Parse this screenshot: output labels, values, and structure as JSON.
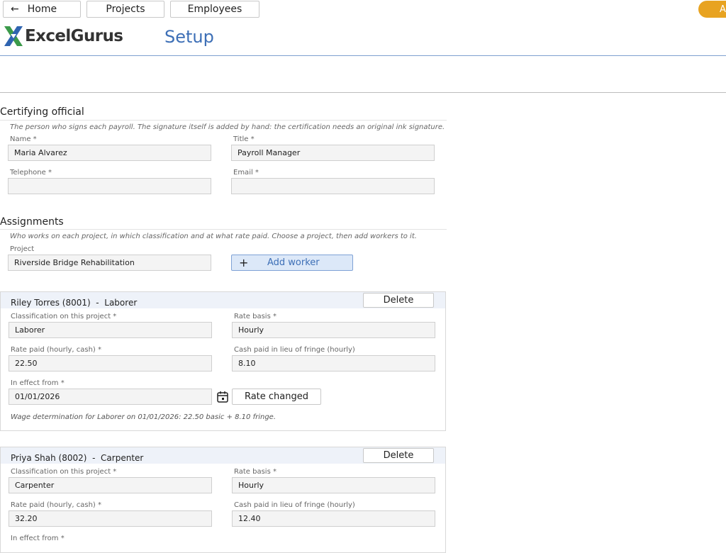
{
  "nav": {
    "home_label": "Home",
    "projects_label": "Projects",
    "employees_label": "Employees",
    "account_initial": "A"
  },
  "brand": {
    "name": "ExcelGurus"
  },
  "page": {
    "title": "Setup"
  },
  "certifying": {
    "title": "Certifying official",
    "hint": "The person who signs each payroll. The signature itself is added by hand: the certification needs an original ink signature.",
    "name_label": "Name *",
    "name_value": "Maria Alvarez",
    "title_label": "Title *",
    "title_value": "Payroll Manager",
    "phone_label": "Telephone *",
    "phone_value": "",
    "email_label": "Email *",
    "email_value": ""
  },
  "assignments": {
    "title": "Assignments",
    "hint": "Who works on each project, in which classification and at what rate paid. Choose a project, then add workers to it.",
    "project_label": "Project",
    "project_value": "Riverside Bridge Rehabilitation",
    "add_worker_label": "Add worker"
  },
  "workers": [
    {
      "header": "Riley Torres (8001)  -  Laborer",
      "delete_label": "Delete",
      "class_label": "Classification on this project *",
      "class_value": "Laborer",
      "basis_label": "Rate basis *",
      "basis_value": "Hourly",
      "rate_label": "Rate paid (hourly, cash) *",
      "rate_value": "22.50",
      "fringe_label": "Cash paid in lieu of fringe (hourly)",
      "fringe_value": "8.10",
      "effective_label": "In effect from *",
      "effective_value": "01/01/2026",
      "rate_changed_label": "Rate changed",
      "note": "Wage determination for Laborer on 01/01/2026: 22.50 basic + 8.10 fringe."
    },
    {
      "header": "Priya Shah (8002)  -  Carpenter",
      "delete_label": "Delete",
      "class_label": "Classification on this project *",
      "class_value": "Carpenter",
      "basis_label": "Rate basis *",
      "basis_value": "Hourly",
      "rate_label": "Rate paid (hourly, cash) *",
      "rate_value": "32.20",
      "fringe_label": "Cash paid in lieu of fringe (hourly)",
      "fringe_value": "12.40",
      "effective_label": "In effect from *"
    }
  ],
  "icons": {
    "back": "arrow-left-icon",
    "add": "plus-icon",
    "calendar": "calendar-icon"
  },
  "colors": {
    "accent": "#3d6fb6",
    "account": "#e8a321",
    "logo_green": "#3b9a4a",
    "logo_blue": "#2f64b0"
  }
}
